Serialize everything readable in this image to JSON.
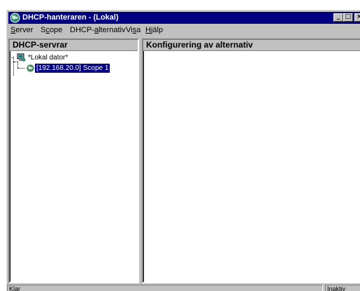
{
  "window": {
    "title": "DHCP-hanteraren - (Lokal)"
  },
  "menu": [
    {
      "label": "Server",
      "accel": "S",
      "pre": "",
      "post": "erver"
    },
    {
      "label": "Scope",
      "accel": "c",
      "pre": "S",
      "post": "ope"
    },
    {
      "label": "DHCP-alternativ",
      "accel": "a",
      "pre": "DHCP-",
      "post": "lternativ"
    },
    {
      "label": "Visa",
      "accel": "s",
      "pre": "Vi",
      "post": "a"
    },
    {
      "label": "Hjälp",
      "accel": "H",
      "pre": "",
      "post": "jälp"
    }
  ],
  "left_pane": {
    "header": "DHCP-servrar",
    "tree": [
      {
        "label": "*Lokal dator*",
        "expander": "-"
      },
      {
        "label": "[192.168.20.0] Scope 1",
        "selected": true
      }
    ]
  },
  "right_pane": {
    "header": "Konfigurering av alternativ"
  },
  "status": {
    "main": "Klar",
    "right": "Inaktiv"
  },
  "icons": {
    "app": "dhcp-globe-icon",
    "server": "server-computer-icon",
    "scope": "scope-globe-icon"
  }
}
